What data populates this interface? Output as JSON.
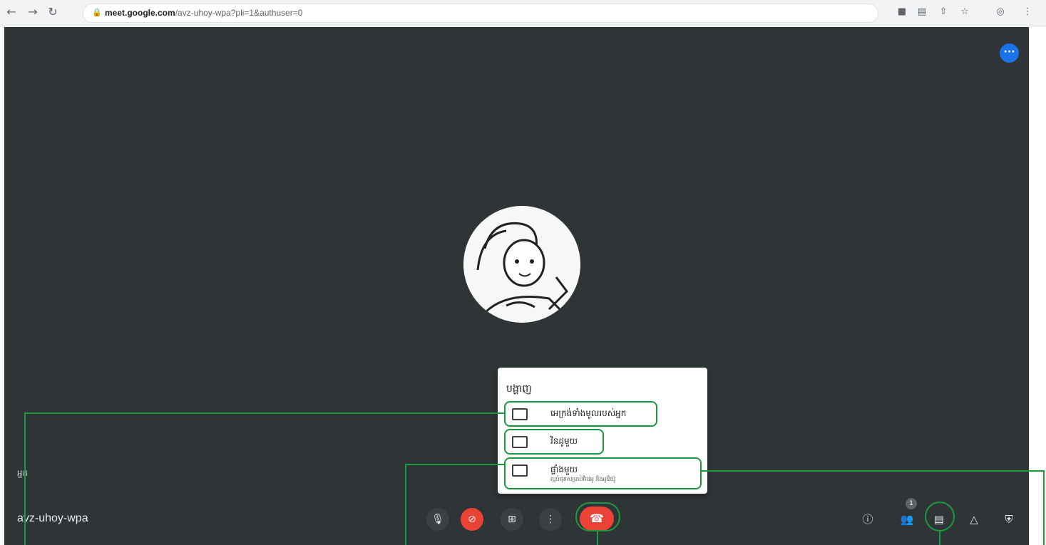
{
  "browser": {
    "back_icon": "back-arrow-icon",
    "forward_icon": "forward-arrow-icon",
    "reload_icon": "reload-icon",
    "url_host": "meet.google.com",
    "url_path": "/avz-uhoy-wpa?pli=1&authuser=0"
  },
  "meet": {
    "participant_label": "អ្នក",
    "meeting_code": "avz-uhoy-wpa",
    "participants_count": "1"
  },
  "present_menu": {
    "title": "បង្ហាញ",
    "items": [
      {
        "label": "អេក្រង់ទាំងមូលរបស់អ្នក",
        "icon": "monitor-icon"
      },
      {
        "label": "វិនដូមួយ",
        "icon": "window-icon"
      },
      {
        "label": "ផ្ទាំងមួយ",
        "sublabel": "ល្អបំផុតសម្រាប់វីដេអូ និងអូឌីយ៉ូ",
        "icon": "tab-icon"
      }
    ]
  },
  "colors": {
    "stage_bg": "#2f3537",
    "end_call": "#ea4335",
    "annotation": "#1a9a3e",
    "accent": "#1a73e8"
  }
}
